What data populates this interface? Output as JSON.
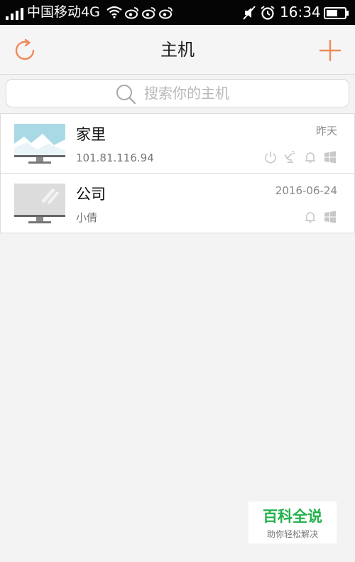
{
  "status_bar": {
    "carrier": "中国移动4G",
    "time": "16:34"
  },
  "header": {
    "title": "主机"
  },
  "search": {
    "placeholder": "搜索你的主机"
  },
  "hosts": [
    {
      "name": "家里",
      "subtitle": "101.81.116.94",
      "time": "昨天",
      "icons": [
        "power-icon",
        "satellite-icon",
        "bell-icon",
        "windows-icon"
      ]
    },
    {
      "name": "公司",
      "subtitle": "小倩",
      "time": "2016-06-24",
      "icons": [
        "bell-icon",
        "windows-icon"
      ]
    }
  ],
  "watermark": {
    "title": "百科全说",
    "subtitle": "助你轻松解决"
  },
  "colors": {
    "accent": "#ee8a5a",
    "status_bar": "#050505",
    "background": "#f3f3f3",
    "watermark_green": "#22b14c",
    "icon_gray": "#c8c8c8"
  }
}
